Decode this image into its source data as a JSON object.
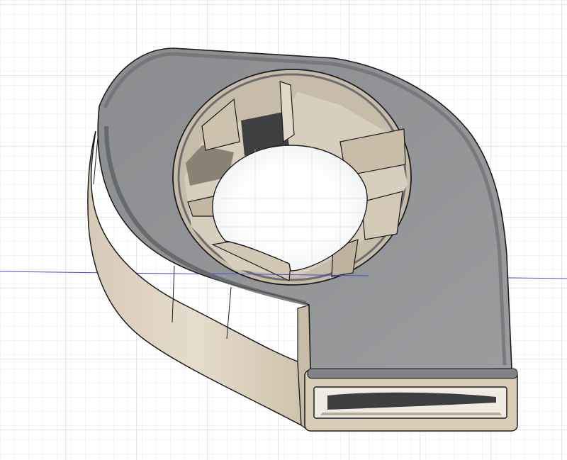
{
  "viewport": {
    "background": "#ffffff",
    "grid_minor_color": "#e6e9ee",
    "grid_major_color": "#c9ced6",
    "axis_color": "#3b3bd6",
    "grid_visible": true
  },
  "model": {
    "object": "blower-fan-housing",
    "top_face_color": "#8d8f91",
    "side_face_color": "#d9cfbf",
    "inner_wall_color": "#c4b9a8",
    "edge_color": "#1c1c1c",
    "fillet_color": "#6c6e70",
    "vane_count": 6,
    "outlet": "rectangular-duct"
  }
}
